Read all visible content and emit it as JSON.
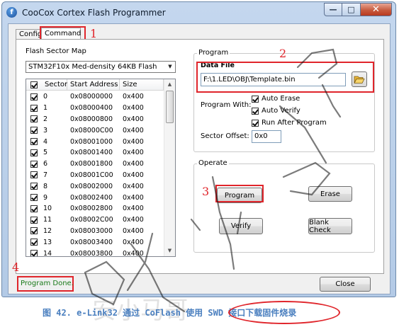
{
  "window": {
    "title": "CooCox Cortex Flash Programmer",
    "app_icon_letter": "f",
    "buttons": {
      "minimize": "—",
      "maximize": "□",
      "close": "✕"
    }
  },
  "tabs": [
    {
      "label": "Config",
      "active": false
    },
    {
      "label": "Command",
      "active": true
    }
  ],
  "flash_sector_map": {
    "label": "Flash Sector Map",
    "device": "STM32F10x Med-density 64KB Flash",
    "columns": [
      "Sector",
      "Start Address",
      "Size"
    ],
    "rows": [
      {
        "sector": "0",
        "address": "0x08000000",
        "size": "0x400"
      },
      {
        "sector": "1",
        "address": "0x08000400",
        "size": "0x400"
      },
      {
        "sector": "2",
        "address": "0x08000800",
        "size": "0x400"
      },
      {
        "sector": "3",
        "address": "0x08000C00",
        "size": "0x400"
      },
      {
        "sector": "4",
        "address": "0x08001000",
        "size": "0x400"
      },
      {
        "sector": "5",
        "address": "0x08001400",
        "size": "0x400"
      },
      {
        "sector": "6",
        "address": "0x08001800",
        "size": "0x400"
      },
      {
        "sector": "7",
        "address": "0x08001C00",
        "size": "0x400"
      },
      {
        "sector": "8",
        "address": "0x08002000",
        "size": "0x400"
      },
      {
        "sector": "9",
        "address": "0x08002400",
        "size": "0x400"
      },
      {
        "sector": "10",
        "address": "0x08002800",
        "size": "0x400"
      },
      {
        "sector": "11",
        "address": "0x08002C00",
        "size": "0x400"
      },
      {
        "sector": "12",
        "address": "0x08003000",
        "size": "0x400"
      },
      {
        "sector": "13",
        "address": "0x08003400",
        "size": "0x400"
      },
      {
        "sector": "14",
        "address": "0x08003800",
        "size": "0x400"
      }
    ]
  },
  "program": {
    "group_title": "Program",
    "data_file_label": "Data File",
    "data_file_path": "F:\\1.LED\\OBJ\\Template.bin",
    "program_with_label": "Program With:",
    "options": [
      {
        "label": "Auto Erase",
        "checked": true
      },
      {
        "label": "Auto Verify",
        "checked": true
      },
      {
        "label": "Run After Program",
        "checked": true
      }
    ],
    "sector_offset_label": "Sector Offset:",
    "sector_offset_value": "0x0"
  },
  "operate": {
    "group_title": "Operate",
    "buttons": {
      "program": "Program",
      "erase": "Erase",
      "verify": "Verify",
      "blank_check": "Blank Check"
    }
  },
  "status": "Program Done.",
  "close_button": "Close",
  "annotations": [
    "1",
    "2",
    "3",
    "4"
  ],
  "caption": "图 42. e-Link32 通过 CoFlash 使用 SWD 接口下载固件烧录",
  "watermark": "安小马哥",
  "colors": {
    "annotation": "#e0252b",
    "status": "#1a7a1a",
    "caption": "#4a7fbf"
  }
}
